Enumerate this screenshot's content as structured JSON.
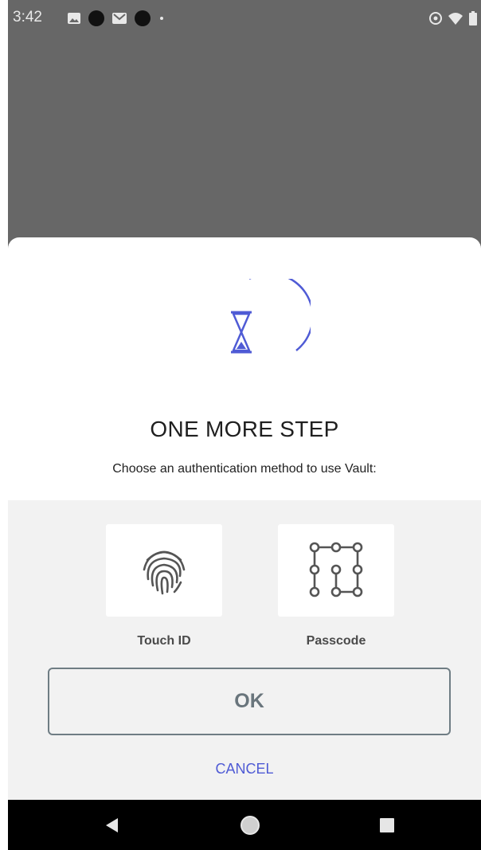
{
  "status_bar": {
    "time": "3:42",
    "icons": [
      "image-icon",
      "dot-icon",
      "gmail-icon",
      "dot-icon",
      "small-dot-icon",
      "eye-icon",
      "wifi-icon",
      "battery-icon"
    ]
  },
  "dialog": {
    "icon": "hourglass-icon",
    "title": "ONE MORE STEP",
    "subtitle": "Choose an authentication method to use Vault:",
    "options": [
      {
        "label": "Touch ID",
        "icon": "fingerprint-icon"
      },
      {
        "label": "Passcode",
        "icon": "passcode-pattern-icon"
      }
    ],
    "ok_label": "OK",
    "cancel_label": "CANCEL"
  },
  "colors": {
    "accent": "#4f5bd5",
    "scrim": "#676767",
    "panel": "#f2f2f2",
    "ok_text": "#69757c"
  },
  "nav_bar": {
    "buttons": [
      "back-icon",
      "home-icon",
      "recents-icon"
    ]
  }
}
